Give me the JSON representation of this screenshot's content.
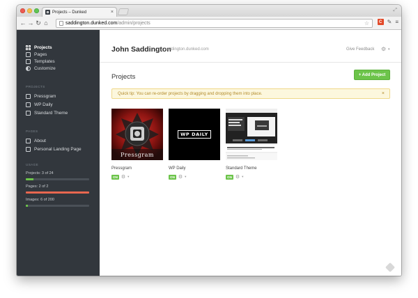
{
  "browser": {
    "tab_title": "Projects – Dunked",
    "url_host": "saddington.dunked.com",
    "url_path": "/admin/projects"
  },
  "sidebar": {
    "primary": [
      {
        "label": "Projects",
        "icon": "grid-icon",
        "active": true
      },
      {
        "label": "Pages",
        "icon": "page-icon",
        "active": false
      },
      {
        "label": "Templates",
        "icon": "template-icon",
        "active": false
      },
      {
        "label": "Customize",
        "icon": "palette-icon",
        "active": false
      }
    ],
    "projects_title": "PROJECTS",
    "projects": [
      {
        "label": "Pressgram"
      },
      {
        "label": "WP Daily"
      },
      {
        "label": "Standard Theme"
      }
    ],
    "pages_title": "PAGES",
    "pages": [
      {
        "label": "About"
      },
      {
        "label": "Personal Landing Page"
      }
    ],
    "usage_title": "USAGE",
    "usage": [
      {
        "label": "Projects: 3 of 24",
        "fraction": 0.125,
        "color": "#6cc44a"
      },
      {
        "label": "Pages: 2 of 2",
        "fraction": 1.0,
        "color": "#e8674f"
      },
      {
        "label": "Images: 6 of 200",
        "fraction": 0.03,
        "color": "#6cc44a"
      }
    ]
  },
  "header": {
    "user_name": "John Saddington",
    "user_domain": "saddington.dunked.com",
    "feedback": "Give Feedback"
  },
  "main": {
    "title": "Projects",
    "add_button": "+ Add Project",
    "tip": "Quick tip: You can re-order projects by dragging and dropping them into place.",
    "tip_close": "×"
  },
  "projects": [
    {
      "name": "Pressgram",
      "status": "ON"
    },
    {
      "name": "WP Daily",
      "status": "ON",
      "logo_text": "WP DAILY"
    },
    {
      "name": "Standard Theme",
      "status": "ON"
    }
  ],
  "colors": {
    "sidebar_bg": "#32373d",
    "accent_green": "#6cc44a",
    "tip_bg": "#fcf7dd"
  }
}
